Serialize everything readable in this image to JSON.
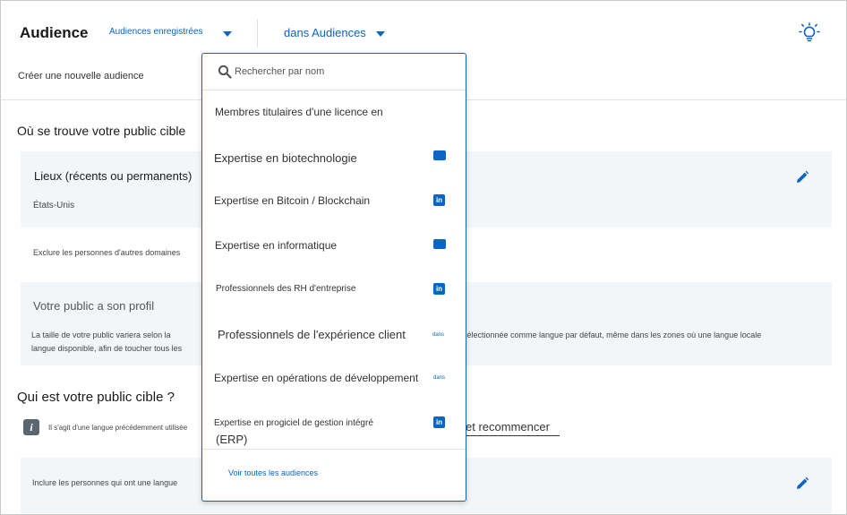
{
  "header": {
    "title": "Audience",
    "saved_audiences_label": "Audiences enregistrées",
    "scope_label": "dans Audiences",
    "create_new_label": "Créer une nouvelle audience"
  },
  "location_section": {
    "title": "Où se trouve votre public cible",
    "card_title": "Lieux (récents ou permanents)",
    "value": "États-Unis",
    "exclude_label": "Exclure les personnes d'autres domaines"
  },
  "profile_section": {
    "title": "Votre public a son profil",
    "text_line1": "La taille de votre public variera selon la",
    "text_line2": "langue disponible, afin de toucher tous les",
    "text_right": "sélectionnée comme langue par défaut, même dans les zones où une langue locale"
  },
  "who_section": {
    "title": "Qui est votre public cible ?",
    "info_icon_glyph": "i",
    "info_text": "Il s'agit d'une langue précédemment utilisée",
    "restart_label": "et recommencer",
    "include_label": "Inclure les personnes qui ont une langue"
  },
  "dropdown": {
    "search_placeholder": "Rechercher par nom",
    "items": [
      {
        "label": "Membres titulaires d'une licence en",
        "badge": "",
        "badge_type": "none"
      },
      {
        "label": "Expertise en biotechnologie",
        "badge": "",
        "badge_type": "image"
      },
      {
        "label": "Expertise en Bitcoin / Blockchain",
        "badge": "in",
        "badge_type": "linkedin"
      },
      {
        "label": "Expertise en informatique",
        "badge": "",
        "badge_type": "image"
      },
      {
        "label": "Professionnels des RH d'entreprise",
        "badge": "in",
        "badge_type": "linkedin"
      },
      {
        "label": "Professionnels de l'expérience client",
        "badge": "dans",
        "badge_type": "text"
      },
      {
        "label": "Expertise en opérations de développement",
        "badge": "dans",
        "badge_type": "text"
      },
      {
        "label": "Expertise en progiciel de gestion intégré",
        "label_line2": "(ERP)",
        "badge": "in",
        "badge_type": "linkedin"
      }
    ],
    "see_all_label": "Voir toutes les audiences"
  },
  "colors": {
    "accent": "#0a66c2",
    "card_bg": "#f3f6f8",
    "text": "#333333"
  },
  "icons": {
    "bulb": "lightbulb-icon",
    "search": "search-icon",
    "edit": "pencil-icon",
    "info": "info-icon",
    "linkedin": "linkedin-icon",
    "caret": "caret-down-icon"
  }
}
